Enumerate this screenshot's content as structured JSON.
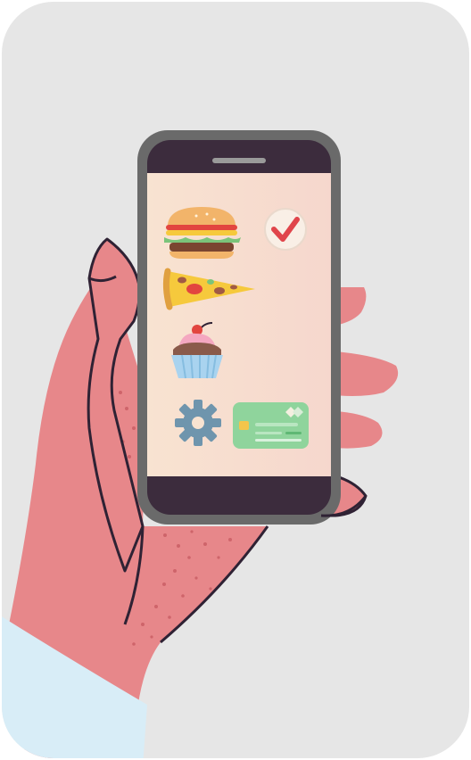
{
  "scene": {
    "kind": "illustration",
    "subject": "hand-holding-phone-food-order",
    "colors": {
      "background": "#e6e6e6",
      "skin": "#e7878a",
      "skin_dark": "#c95c63",
      "outline": "#2f2234",
      "phone_body": "#6a6a6a",
      "phone_bezel": "#3c2c3d",
      "screen_left": "#f8e3d1",
      "screen_right": "#f6d7cd",
      "sleeve": "#d8edf7",
      "check": "#e0454b",
      "card": "#8fd49c",
      "gear": "#6f95ad"
    },
    "icons": [
      "burger-icon",
      "check-icon",
      "pizza-slice-icon",
      "cupcake-icon",
      "gear-icon",
      "credit-card-icon"
    ]
  }
}
